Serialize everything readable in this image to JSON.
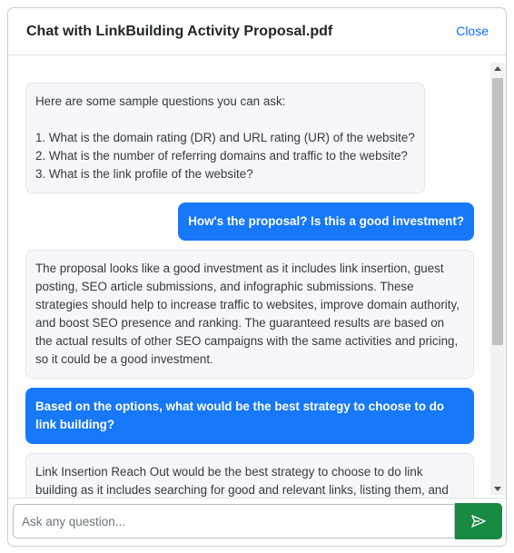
{
  "header": {
    "title": "Chat with LinkBuilding Activity Proposal.pdf",
    "close_label": "Close"
  },
  "messages": [
    {
      "role": "bot",
      "text": "Here are some sample questions you can ask:\n\n1. What is the domain rating (DR) and URL rating (UR) of the website?\n2. What is the number of referring domains and traffic to the website?\n3. What is the link profile of the website?"
    },
    {
      "role": "user",
      "text": "How's the proposal? Is this a good investment?"
    },
    {
      "role": "bot",
      "text": "The proposal looks like a good investment as it includes link insertion, guest posting, SEO article submissions, and infographic submissions. These strategies should help to increase traffic to websites, improve domain authority, and boost SEO presence and ranking. The guaranteed results are based on the actual results of other SEO campaigns with the same activities and pricing, so it could be a good investment."
    },
    {
      "role": "user",
      "text": "Based on the options, what would be the best strategy to choose to do link building?"
    },
    {
      "role": "bot",
      "text": "Link Insertion Reach Out would be the best strategy to choose to do link building as it includes searching for good and relevant links, listing them, and reaching out to webmasters to get links placed in existing content on relevant websites."
    }
  ],
  "composer": {
    "placeholder": "Ask any question...",
    "value": "",
    "send_icon": "send-icon"
  }
}
